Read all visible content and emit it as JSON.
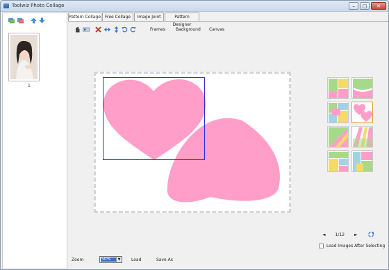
{
  "window": {
    "title": "Toolwiz Photo Collage",
    "minimize_glyph": "–",
    "maximize_glyph": "□",
    "close_glyph": "✕"
  },
  "left_panel": {
    "toolbar_icons": [
      "add-images-icon",
      "remove-images-icon",
      "move-up-icon",
      "move-down-icon"
    ],
    "thumbnails": [
      {
        "index_label": "1"
      }
    ]
  },
  "tabs": [
    {
      "label": "Pattern Collage",
      "active": true
    },
    {
      "label": "Free Collage",
      "active": false
    },
    {
      "label": "Image Joint",
      "active": false
    },
    {
      "label": "Pattern Designer",
      "active": false
    }
  ],
  "toolbar": {
    "icons": [
      "pointer-icon",
      "image-icon",
      "delete-icon",
      "flip-horizontal-icon",
      "flip-vertical-icon",
      "rotate-left-icon",
      "rotate-right-icon"
    ],
    "frames_label": "Frames",
    "background_label": "Background",
    "canvas_label": "Canvas"
  },
  "colors": {
    "heart": "#ff9ec8",
    "selection": "#2c2ce0",
    "accent_blue": "#2f6ad8"
  },
  "pager": {
    "prev": "◄",
    "page": "1/12",
    "next": "►",
    "refresh_icon": "refresh-icon"
  },
  "load_after_selecting": {
    "checked": false,
    "label": "Load Images After Selecting"
  },
  "bottom": {
    "zoom_label": "Zoom",
    "zoom_value": "50%",
    "load_label": "Load",
    "save_as_label": "Save As"
  }
}
